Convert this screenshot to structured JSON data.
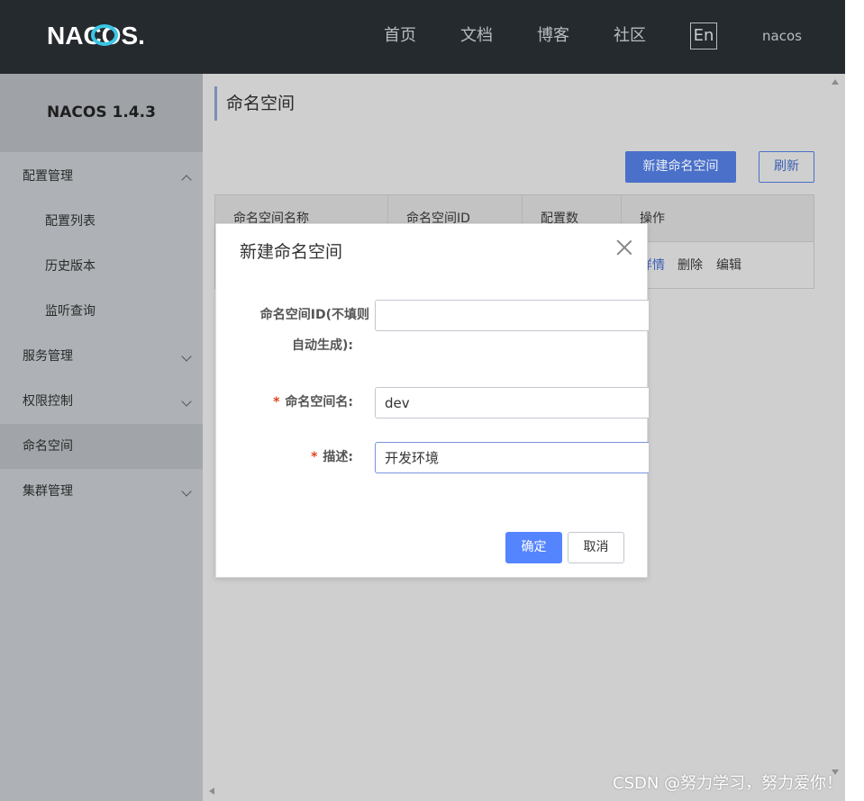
{
  "header": {
    "logo_text": "NACOS.",
    "nav": [
      "首页",
      "文档",
      "博客",
      "社区"
    ],
    "lang_toggle": "En",
    "username": "nacos"
  },
  "sidebar": {
    "title": "NACOS 1.4.3",
    "items": [
      {
        "label": "配置管理",
        "level": 1,
        "expanded": true
      },
      {
        "label": "配置列表",
        "level": 2
      },
      {
        "label": "历史版本",
        "level": 2
      },
      {
        "label": "监听查询",
        "level": 2
      },
      {
        "label": "服务管理",
        "level": 1,
        "expanded": false
      },
      {
        "label": "权限控制",
        "level": 1,
        "expanded": false
      },
      {
        "label": "命名空间",
        "level": 1,
        "active": true
      },
      {
        "label": "集群管理",
        "level": 1,
        "expanded": false
      }
    ]
  },
  "main": {
    "page_title": "命名空间",
    "new_button": "新建命名空间",
    "refresh_button": "刷新",
    "table": {
      "columns": [
        "命名空间名称",
        "命名空间ID",
        "配置数",
        "操作"
      ],
      "row_actions": [
        "详情",
        "删除",
        "编辑"
      ]
    }
  },
  "dialog": {
    "title": "新建命名空间",
    "fields": [
      {
        "label_line1": "命名空间ID(不填则",
        "label_line2": "自动生成):",
        "required": false,
        "value": ""
      },
      {
        "label": "命名空间名:",
        "required": true,
        "value": "dev"
      },
      {
        "label": "描述:",
        "required": true,
        "value": "开发环境"
      }
    ],
    "required_mark": "*",
    "ok_button": "确定",
    "cancel_button": "取消"
  },
  "watermark": "CSDN @努力学习，努力爱你！",
  "colors": {
    "topbar": "#252a2f",
    "primary": "#5584ff",
    "required": "#e0441f"
  }
}
